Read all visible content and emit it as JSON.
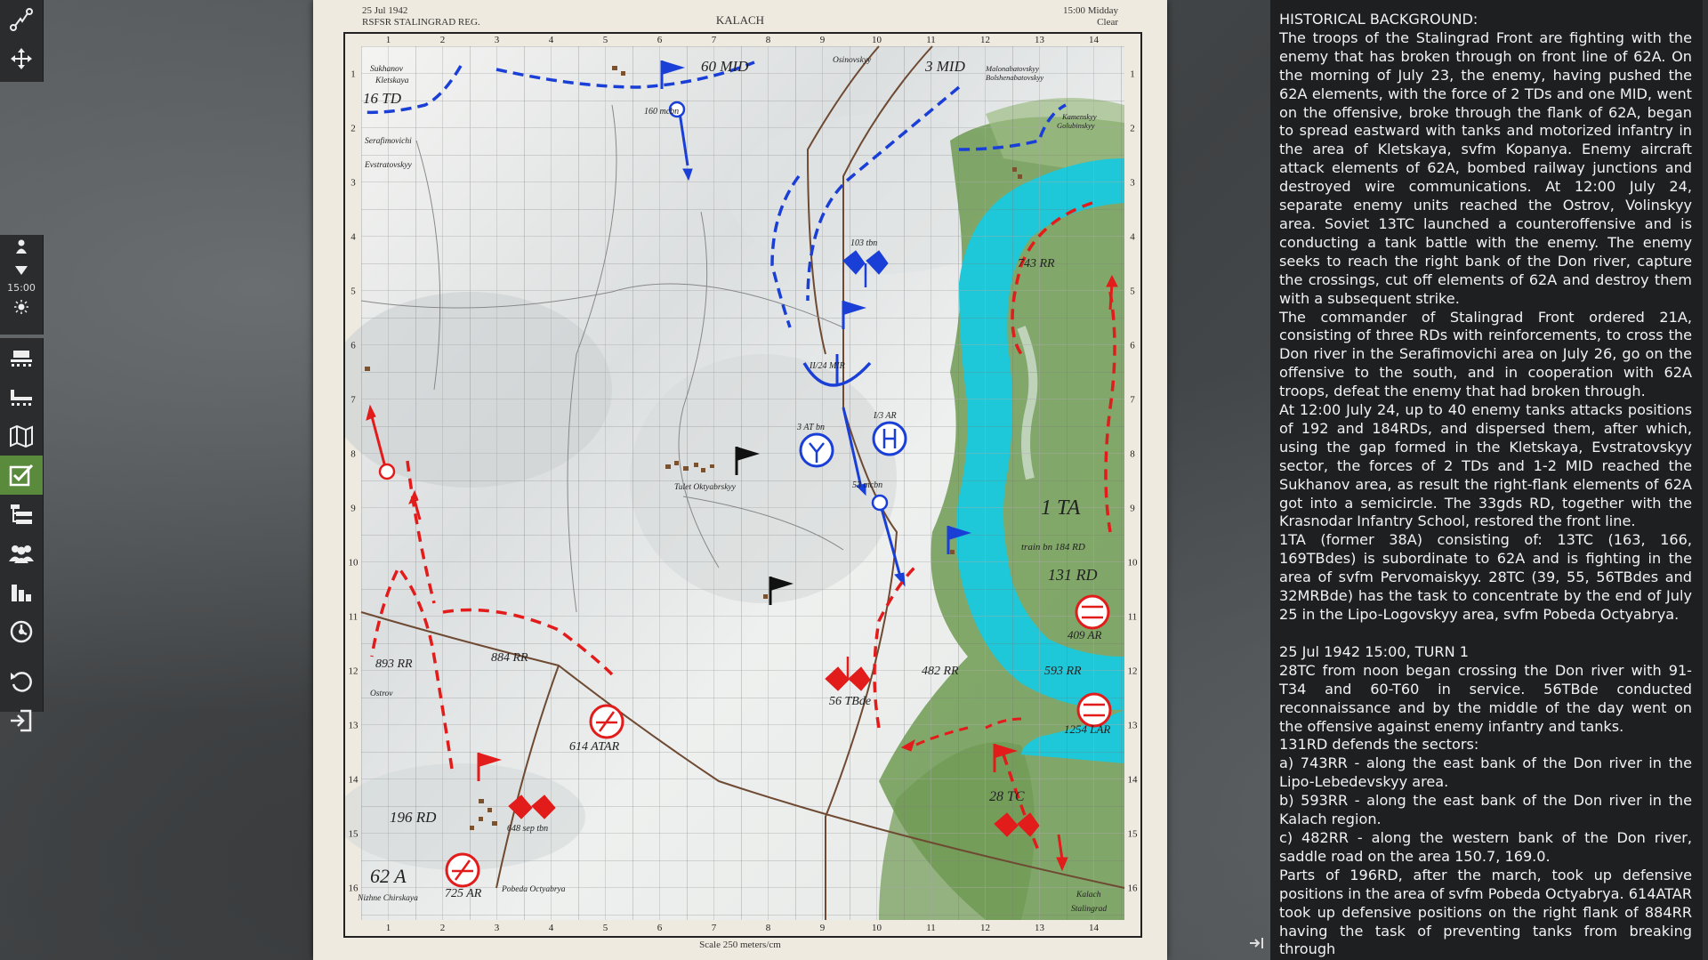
{
  "sheet": {
    "date": "25 Jul 1942",
    "region": "RSFSR STALINGRAD REG.",
    "title": "KALACH",
    "time": "15:00 Midday",
    "weather": "Clear",
    "scale": "Scale 250 meters/cm"
  },
  "toolbar": {
    "time_label": "15:00",
    "icons": [
      "route-icon",
      "move-icon",
      "unit-icon",
      "down-arrow-icon",
      "sun-icon",
      "rail-icon",
      "rail-bridge-icon",
      "map-icon",
      "objectives-icon",
      "order-of-battle-icon",
      "forces-icon",
      "statistics-icon",
      "clock-icon",
      "undo-icon",
      "exit-icon"
    ]
  },
  "map": {
    "grid_cols": [
      "1",
      "2",
      "3",
      "4",
      "5",
      "6",
      "7",
      "8",
      "9",
      "10",
      "11",
      "12",
      "13",
      "14"
    ],
    "grid_rows": [
      "1",
      "2",
      "3",
      "4",
      "5",
      "6",
      "7",
      "8",
      "9",
      "10",
      "11",
      "12",
      "13",
      "14",
      "15",
      "16"
    ],
    "places": [
      "Sukhanov",
      "Kletskaya",
      "Serafimovichi",
      "Evstratovskyy",
      "Osinovskyy",
      "Malonabatovskyy",
      "Bolshenabatovskyy",
      "Kamenskyy",
      "Golubinskyy",
      "Tulet Oktyabrskyy",
      "Ostrov",
      "Pobeda Octyabrya",
      "Nizhne Chirskaya",
      "Kalach",
      "Stalingrad"
    ],
    "german_units": [
      "16 TD",
      "60 MID",
      "3 MID",
      "160 mcbn",
      "103 tbn",
      "II/24 MIR",
      "3 AT bn",
      "I/3 AR",
      "53 mcbn",
      "train bn 184 RD"
    ],
    "soviet_units": [
      "743 RR",
      "1 TA",
      "131 RD",
      "409 AR",
      "593 RR",
      "1254 LAR",
      "482 RR",
      "56 TBde",
      "884 RR",
      "893 RR",
      "614 ATAR",
      "28 TC",
      "196 RD",
      "648 sep tbn",
      "62 A",
      "725 AR"
    ]
  },
  "panel": {
    "paragraphs": [
      "HISTORICAL BACKGROUND:",
      "The troops of the Stalingrad Front are fighting with the enemy that has broken through on front line of 62A. On the morning of July 23, the enemy, having pushed the 62A elements, with the force of 2 TDs and one MID, went on the offensive, broke through the flank of 62A, began to spread eastward with tanks and motorized infantry in the area of Kletskaya, svfm Kopanya. Enemy aircraft attack elements of 62A, bombed railway junctions and destroyed wire communications. At 12:00 July 24, separate enemy units reached the Ostrov, Volinskyy area. Soviet 13TC launched a counteroffensive and is conducting a tank battle with the enemy. The enemy seeks to reach the right bank of the Don river, capture the crossings, cut off elements of 62A and destroy them with a subsequent strike.",
      "The commander of Stalingrad Front ordered 21A, consisting of three RDs with reinforcements, to cross the Don river in the Serafimovichi area on July 26, go on the offensive to the south, and in cooperation with 62A troops, defeat the enemy that had broken through.",
      "At 12:00 July 24, up to 40 enemy tanks attacks positions of 192 and 184RDs, and dispersed them, after which, using the gap formed in the Kletskaya, Evstratovskyy sector, the forces of 2 TDs and 1-2 MID reached the Sukhanov area, as result the right-flank elements of 62A got into a semicircle. The 33gds RD, together with the Krasnodar Infantry School, restored the front line.",
      "1TA (former 38A) consisting of: 13TC (163, 166, 169TBdes) is subordinate to 62A and is fighting in the area of svfm Pervomaiskyy. 28TC (39, 55, 56TBdes and 32MRBde) has the task to concentrate by the end of July 25 in the Lipo-Logovskyy area, svfm Pobeda Octyabrya."
    ],
    "turn_header": "25 Jul 1942  15:00, TURN 1",
    "turn_paragraphs": [
      "28TC from noon began crossing the Don river with 91-T34 and 60-T60 in service. 56TBde conducted reconnaissance and by the middle of the day went on the offensive against enemy infantry and tanks.",
      "131RD defends the sectors:",
      "a) 743RR - along the east bank of the Don river in the Lipo-Lebedevskyy area.",
      "b) 593RR - along the east bank of the Don river in the Kalach region.",
      "c) 482RR - along the western bank of the Don river, saddle road on the area 150.7, 169.0.",
      "Parts of 196RD, after the march, took up defensive positions in the area of svfm Pobeda Octyabrya. 614ATAR took up defensive positions on the right flank of 884RR having the task of preventing tanks from breaking through"
    ]
  },
  "colors": {
    "soviet": "#e21b1b",
    "german": "#1a3fd6",
    "river": "#1ec8d8",
    "forest": "#6f9a52",
    "active_tool": "#5a8a3c"
  }
}
